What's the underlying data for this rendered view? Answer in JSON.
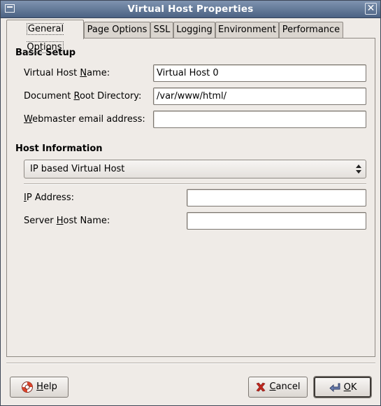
{
  "window": {
    "title": "Virtual Host Properties",
    "close_glyph": "✕"
  },
  "tabs": [
    {
      "label": "General Options",
      "active": true
    },
    {
      "label": "Page Options",
      "active": false
    },
    {
      "label": "SSL",
      "active": false
    },
    {
      "label": "Logging",
      "active": false
    },
    {
      "label": "Environment",
      "active": false
    },
    {
      "label": "Performance",
      "active": false
    }
  ],
  "basic_setup": {
    "heading": "Basic Setup",
    "vhost_name": {
      "label_pre": "Virtual Host ",
      "label_mnemonic": "N",
      "label_post": "ame:",
      "value": "Virtual Host 0"
    },
    "doc_root": {
      "label_pre": "Document ",
      "label_mnemonic": "R",
      "label_post": "oot Directory:",
      "value": "/var/www/html/"
    },
    "webmaster": {
      "label_pre": "",
      "label_mnemonic": "W",
      "label_post": "ebmaster email address:",
      "value": ""
    }
  },
  "host_info": {
    "heading": "Host Information",
    "type_selected": "IP based Virtual Host",
    "ip_address": {
      "label_pre": "",
      "label_mnemonic": "I",
      "label_post": "P Address:",
      "value": ""
    },
    "server_host": {
      "label_pre": "Server ",
      "label_mnemonic": "H",
      "label_post": "ost Name:",
      "value": ""
    }
  },
  "buttons": {
    "help": {
      "mnemonic": "H",
      "rest": "elp",
      "icon": "lifebuoy-icon"
    },
    "cancel": {
      "mnemonic": "C",
      "rest": "ancel",
      "icon": "x-icon"
    },
    "ok": {
      "mnemonic": "O",
      "rest": "K",
      "icon": "enter-arrow-icon"
    }
  },
  "colors": {
    "titlebar": "#5a6f90",
    "background": "#efebe7",
    "cancel_icon": "#c0281e",
    "help_icon": "#d8432b"
  }
}
